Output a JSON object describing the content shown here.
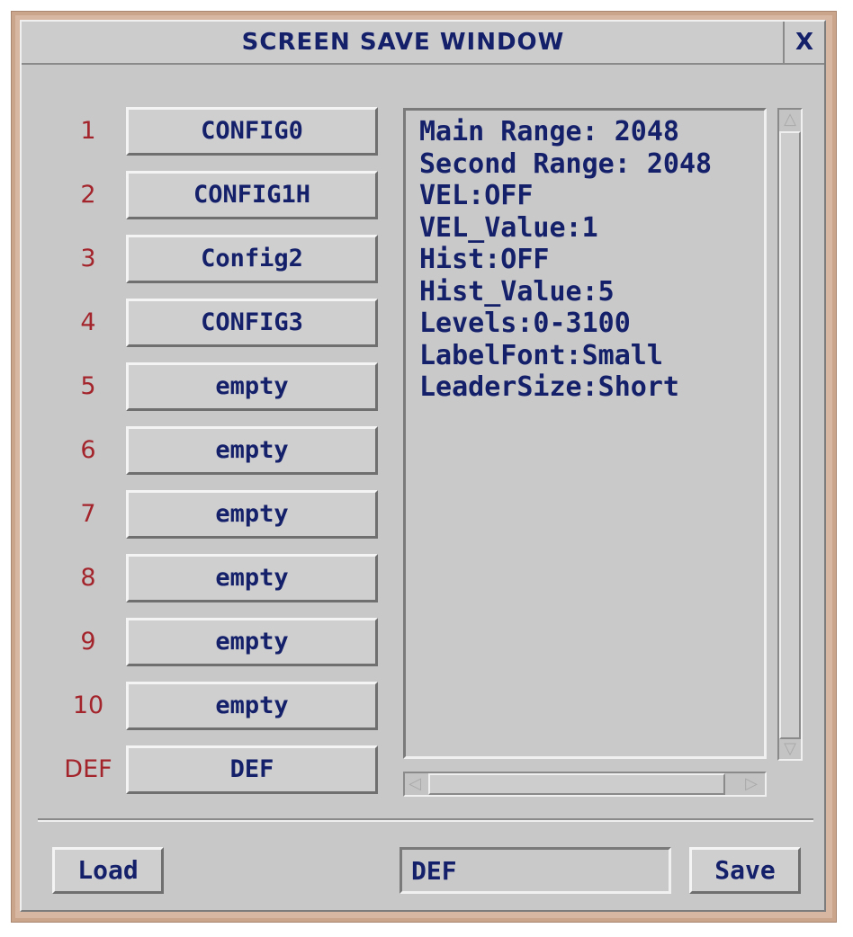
{
  "window": {
    "title": "SCREEN SAVE WINDOW",
    "close_label": "X"
  },
  "slots": [
    {
      "number": "1",
      "label": "CONFIG0"
    },
    {
      "number": "2",
      "label": "CONFIG1H"
    },
    {
      "number": "3",
      "label": "Config2"
    },
    {
      "number": "4",
      "label": "CONFIG3"
    },
    {
      "number": "5",
      "label": "empty"
    },
    {
      "number": "6",
      "label": "empty"
    },
    {
      "number": "7",
      "label": "empty"
    },
    {
      "number": "8",
      "label": "empty"
    },
    {
      "number": "9",
      "label": "empty"
    },
    {
      "number": "10",
      "label": "empty"
    },
    {
      "number": "DEF",
      "label": "DEF"
    }
  ],
  "info": {
    "lines": [
      "Main Range: 2048",
      "Second Range: 2048",
      "VEL:OFF",
      "VEL_Value:1",
      "Hist:OFF",
      "Hist_Value:5",
      "Levels:0-3100",
      "LabelFont:Small",
      "LeaderSize:Short"
    ]
  },
  "footer": {
    "load_label": "Load",
    "name_value": "DEF",
    "save_label": "Save"
  },
  "icons": {
    "scroll_up": "triangle-up-icon",
    "scroll_down": "triangle-down-icon",
    "scroll_left": "triangle-left-icon",
    "scroll_right": "triangle-right-icon"
  },
  "colors": {
    "label_blue": "#14206a",
    "number_red": "#a4242c",
    "panel_gray": "#c8c8c8",
    "frame_tan": "#d8b7a2"
  }
}
